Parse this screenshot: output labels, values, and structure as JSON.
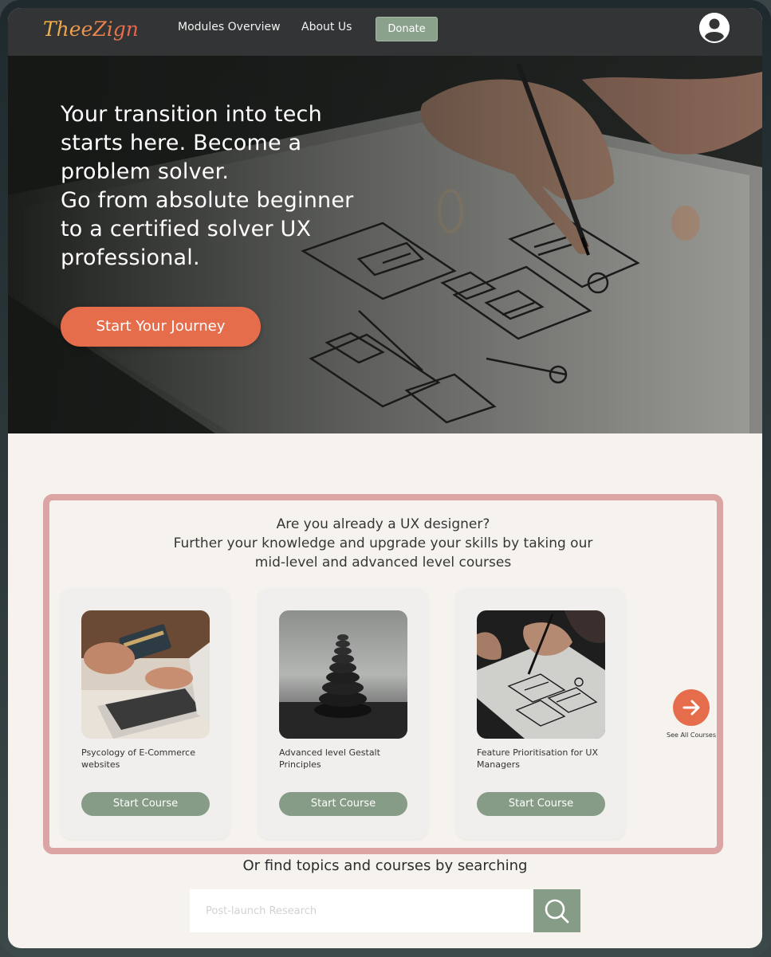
{
  "nav": {
    "logo": "TheeZign",
    "links": [
      "Modules Overview",
      "About Us"
    ],
    "donate": "Donate",
    "profile_icon": "user-circle-icon"
  },
  "hero": {
    "lines": [
      "Your transition into tech",
      "starts here. Become a",
      "problem solver.",
      "Go from absolute beginner",
      "to a certified solver UX",
      "professional."
    ],
    "cta": "Start Your Journey"
  },
  "courses": {
    "heading": [
      "Are you already a UX designer?",
      "Further your knowledge and upgrade your skills by taking our",
      "mid-level and advanced level courses"
    ],
    "items": [
      {
        "title": "Psycology of E-Commerce websites",
        "button": "Start Course"
      },
      {
        "title": "Advanced level Gestalt Principles",
        "button": "Start Course"
      },
      {
        "title": "Feature Prioritisation for UX Managers",
        "button": "Start Course"
      }
    ],
    "see_all": "See All Courses"
  },
  "search": {
    "heading": "Or find topics and courses by searching",
    "placeholder": "Post-launch Research",
    "icon": "search-icon"
  },
  "colors": {
    "accent": "#e56d4b",
    "sage": "#869c86",
    "panel_border": "#dba5a3",
    "nav_bg": "#333435"
  }
}
